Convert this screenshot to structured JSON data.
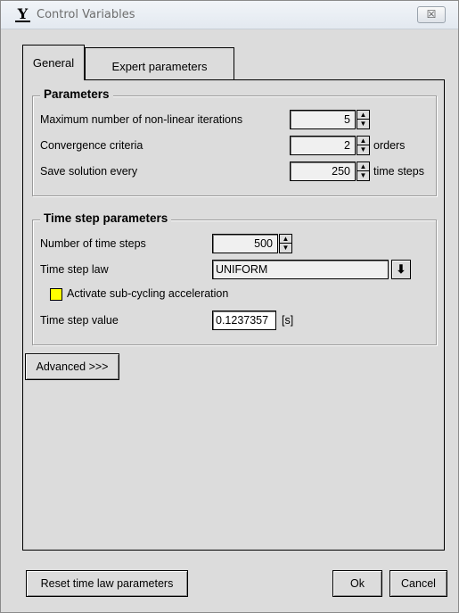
{
  "window": {
    "title": "Control Variables",
    "close_glyph": "☒",
    "app_icon_glyph": "Y"
  },
  "tabs": [
    {
      "label": "General",
      "active": true
    },
    {
      "label": "Expert parameters",
      "active": false
    }
  ],
  "parameters": {
    "title": "Parameters",
    "rows": [
      {
        "label": "Maximum number of non-linear iterations",
        "value": "5",
        "unit": ""
      },
      {
        "label": "Convergence criteria",
        "value": "2",
        "unit": "orders"
      },
      {
        "label": "Save solution every",
        "value": "250",
        "unit": "time steps"
      }
    ]
  },
  "time_step": {
    "title": "Time step parameters",
    "num_steps_label": "Number of time steps",
    "num_steps_value": "500",
    "law_label": "Time step law",
    "law_value": "UNIFORM",
    "subcycling_label": "Activate sub-cycling acceleration",
    "value_label": "Time step value",
    "value": "0.1237357",
    "value_unit": "[s]"
  },
  "buttons": {
    "advanced": "Advanced >>>",
    "reset": "Reset time law parameters",
    "ok": "Ok",
    "cancel": "Cancel"
  },
  "glyphs": {
    "spin_up": "▲",
    "spin_down": "▼",
    "dropdown": "⬇"
  },
  "colors": {
    "checkbox": "#ffff00",
    "window_bg": "#dcdcdc"
  }
}
